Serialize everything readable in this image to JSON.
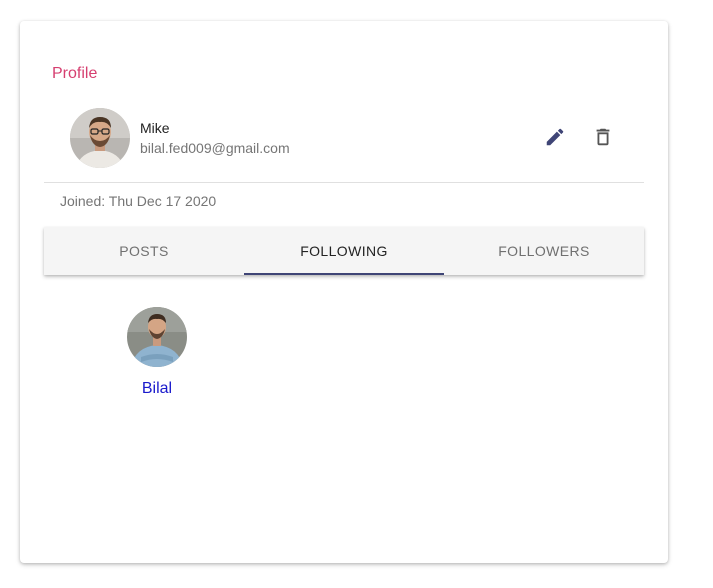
{
  "profile": {
    "title": "Profile",
    "name": "Mike",
    "email": "bilal.fed009@gmail.com",
    "joined": "Joined: Thu Dec 17 2020",
    "actions": {
      "edit_icon": "pencil-icon",
      "delete_icon": "trash-icon"
    }
  },
  "tabs": [
    {
      "label": "POSTS",
      "active": false
    },
    {
      "label": "FOLLOWING",
      "active": true
    },
    {
      "label": "FOLLOWERS",
      "active": false
    }
  ],
  "following": [
    {
      "name": "Bilal"
    }
  ],
  "colors": {
    "title": "#d63f70",
    "tab_indicator": "#3f4576",
    "link": "#1a1acc",
    "icon": "#3f4576"
  }
}
